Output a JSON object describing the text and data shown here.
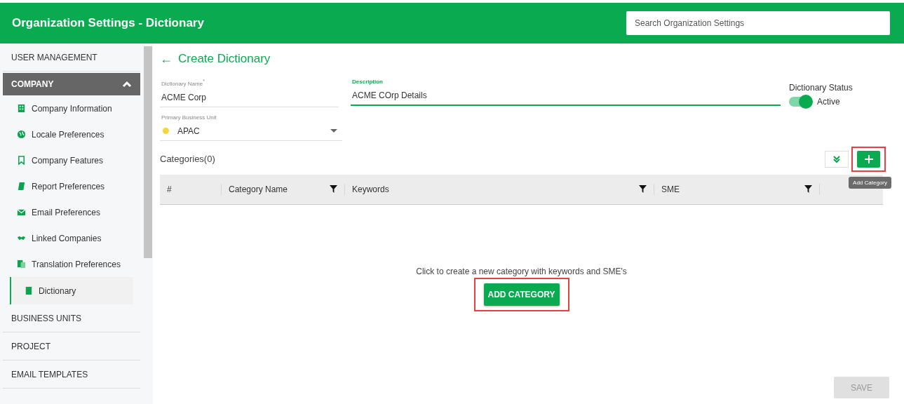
{
  "header": {
    "title": "Organization Settings - Dictionary",
    "search": {
      "placeholder": "Search Organization Settings"
    }
  },
  "sidebar": {
    "sections": [
      {
        "label": "USER MANAGEMENT",
        "expanded": false
      },
      {
        "label": "COMPANY",
        "expanded": true,
        "items": [
          {
            "label": "Company Information",
            "selected": false
          },
          {
            "label": "Locale Preferences",
            "selected": false
          },
          {
            "label": "Company Features",
            "selected": false
          },
          {
            "label": "Report Preferences",
            "selected": false
          },
          {
            "label": "Email Preferences",
            "selected": false
          },
          {
            "label": "Linked Companies",
            "selected": false
          },
          {
            "label": "Translation Preferences",
            "selected": false
          },
          {
            "label": "Dictionary",
            "selected": true
          }
        ]
      },
      {
        "label": "BUSINESS UNITS",
        "expanded": false
      },
      {
        "label": "PROJECT",
        "expanded": false
      },
      {
        "label": "EMAIL TEMPLATES",
        "expanded": false
      }
    ]
  },
  "page": {
    "back": "←",
    "title": "Create Dictionary"
  },
  "form": {
    "name": {
      "label": "Dictionary Name",
      "required_mark": "*",
      "value": "ACME Corp",
      "focused": false
    },
    "description": {
      "label": "Description",
      "value": "ACME COrp Details",
      "focused": true
    },
    "status": {
      "label": "Dictionary Status",
      "on": true,
      "text": "Active"
    },
    "business_unit": {
      "label": "Primary Business Unit",
      "value": "APAC",
      "color": "#f5d63a"
    }
  },
  "categories": {
    "title": "Categories(0)",
    "tooltip": "Add Category",
    "columns": [
      {
        "label": "#",
        "filter": false
      },
      {
        "label": "Category Name",
        "filter": true
      },
      {
        "label": "Keywords",
        "filter": true
      },
      {
        "label": "SME",
        "filter": true
      }
    ],
    "empty_message": "Click to create a new category with keywords and SME's",
    "add_button": "ADD CATEGORY"
  },
  "save_button": {
    "label": "SAVE",
    "disabled": true
  }
}
